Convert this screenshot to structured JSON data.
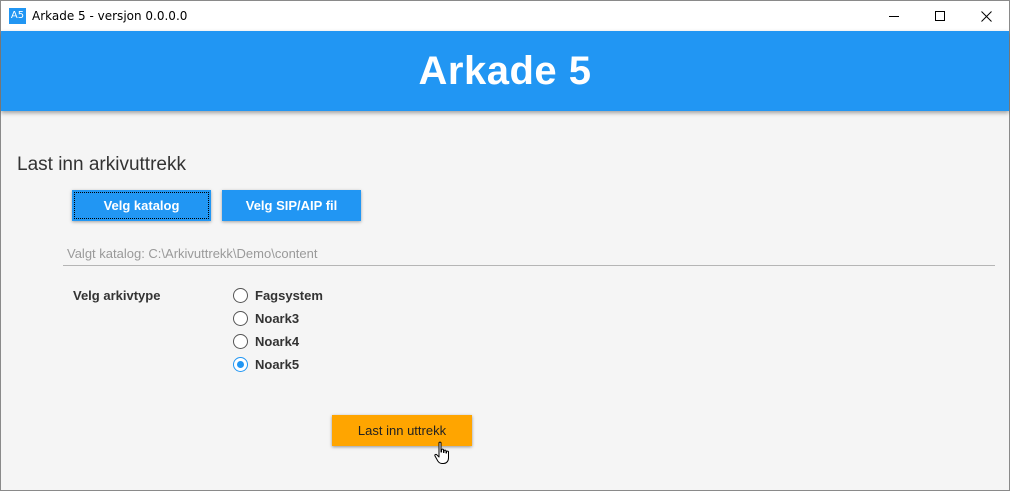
{
  "window": {
    "icon_text": "A5",
    "title": "Arkade 5 - versjon 0.0.0.0"
  },
  "header": {
    "title": "Arkade 5",
    "color": "#2196f3"
  },
  "main": {
    "section_title": "Last inn arkivuttrekk",
    "buttons": {
      "choose_catalog": "Velg katalog",
      "choose_sip_aip": "Velg SIP/AIP fil",
      "load_extract": "Last inn uttrekk"
    },
    "selected_path": "Valgt katalog: C:\\Arkivuttrekk\\Demo\\content",
    "archive_type_label": "Velg arkivtype",
    "archive_types": [
      {
        "label": "Fagsystem",
        "checked": false
      },
      {
        "label": "Noark3",
        "checked": false
      },
      {
        "label": "Noark4",
        "checked": false
      },
      {
        "label": "Noark5",
        "checked": true
      }
    ]
  },
  "colors": {
    "accent": "#2196f3",
    "load_button": "#ffa500"
  }
}
